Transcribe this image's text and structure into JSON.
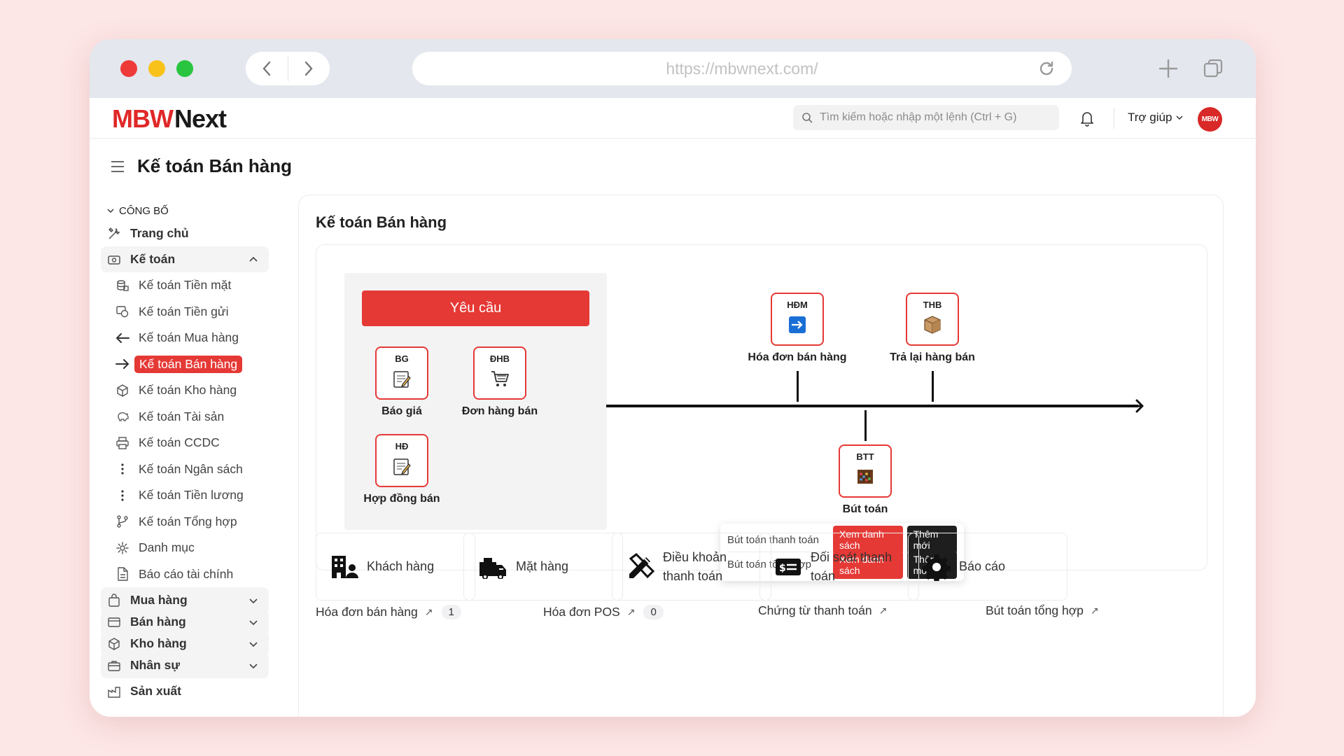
{
  "browser": {
    "url": "https://mbwnext.com/"
  },
  "header": {
    "logo_mbw": "MBW",
    "logo_next": "Next",
    "search_placeholder": "Tìm kiếm hoặc nhập một lệnh (Ctrl + G)",
    "help_label": "Trợ giúp",
    "avatar_text": "MBW"
  },
  "page": {
    "title": "Kế toán Bán hàng"
  },
  "sidebar": {
    "section": "CÔNG BỐ",
    "home": "Trang chủ",
    "accounting": "Kế toán",
    "sub_items": [
      "Kế toán Tiền mặt",
      "Kế toán Tiền gửi",
      "Kế toán Mua hàng",
      "Kế toán Bán hàng",
      "Kế toán Kho hàng",
      "Kế toán Tài sản",
      "Kế toán CCDC",
      "Kế toán Ngân sách",
      "Kế toán Tiền lương",
      "Kế toán Tổng hợp",
      "Danh mục",
      "Báo cáo tài chính"
    ],
    "groups": [
      "Mua hàng",
      "Bán hàng",
      "Kho hàng",
      "Nhân sự"
    ],
    "production": "Sản xuất"
  },
  "card": {
    "title": "Kế toán Bán hàng",
    "request_button": "Yêu cầu",
    "docs": {
      "bg": {
        "code": "BG",
        "name": "Báo giá"
      },
      "dhb": {
        "code": "ĐHB",
        "name": "Đơn hàng bán"
      },
      "hd": {
        "code": "HĐ",
        "name": "Hợp đồng bán"
      },
      "hdm": {
        "code": "HĐM",
        "name": "Hóa đơn bán hàng"
      },
      "thb": {
        "code": "THB",
        "name": "Trả lại hàng bán"
      },
      "btt": {
        "code": "BTT",
        "name": "Bút toán"
      }
    },
    "popup": {
      "rows": [
        {
          "label": "Bút toán thanh toán",
          "view": "Xem danh sách",
          "add": "Thêm mới"
        },
        {
          "label": "Bút toán tổng hợp",
          "view": "Xem danh sách",
          "add": "Thêm mới"
        }
      ]
    },
    "tiles": {
      "customer": "Khách hàng",
      "item": "Mặt hàng",
      "terms_1": "Điều khoản",
      "terms_2": "thanh toán",
      "recon_1": "Đối soát thanh",
      "recon_2": "toán",
      "report": "Báo cáo"
    },
    "links": {
      "invoice": "Hóa đơn bán hàng",
      "invoice_count": "1",
      "pos": "Hóa đơn POS",
      "pos_count": "0",
      "payment_voucher": "Chứng từ thanh toán",
      "general_entry": "Bút toán tổng hợp",
      "arrow": "↗"
    }
  },
  "colors": {
    "accent": "#e53935",
    "dark": "#1e1e1e",
    "background": "#fde6e6"
  }
}
